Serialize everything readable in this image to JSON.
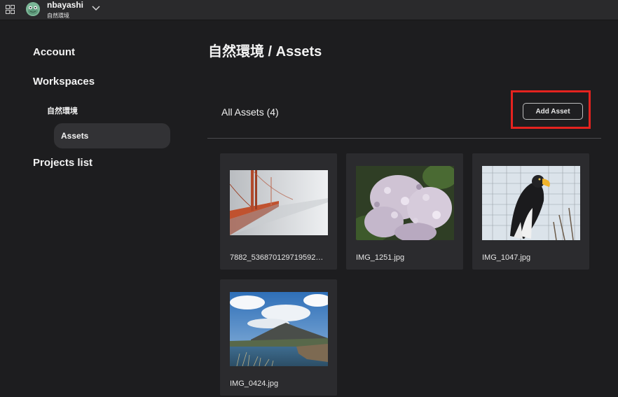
{
  "user": {
    "name": "nbayashi",
    "workspace": "自然環境"
  },
  "sidebar": {
    "account": "Account",
    "workspaces": "Workspaces",
    "workspace_item": "自然環境",
    "assets": "Assets",
    "projects": "Projects list"
  },
  "main": {
    "title": "自然環境 / Assets",
    "section_label": "All Assets (4)",
    "add_button": "Add Asset",
    "assets": [
      {
        "filename": "7882_536870129719592…"
      },
      {
        "filename": "IMG_1251.jpg"
      },
      {
        "filename": "IMG_1047.jpg"
      },
      {
        "filename": "IMG_0424.jpg"
      }
    ]
  },
  "icons": {
    "apps": "grid-icon",
    "dropdown": "chevron-down-icon",
    "avatar": "frog-avatar"
  },
  "colors": {
    "background": "#1d1d1f",
    "card": "#2b2b2e",
    "highlight": "#e5231f"
  }
}
